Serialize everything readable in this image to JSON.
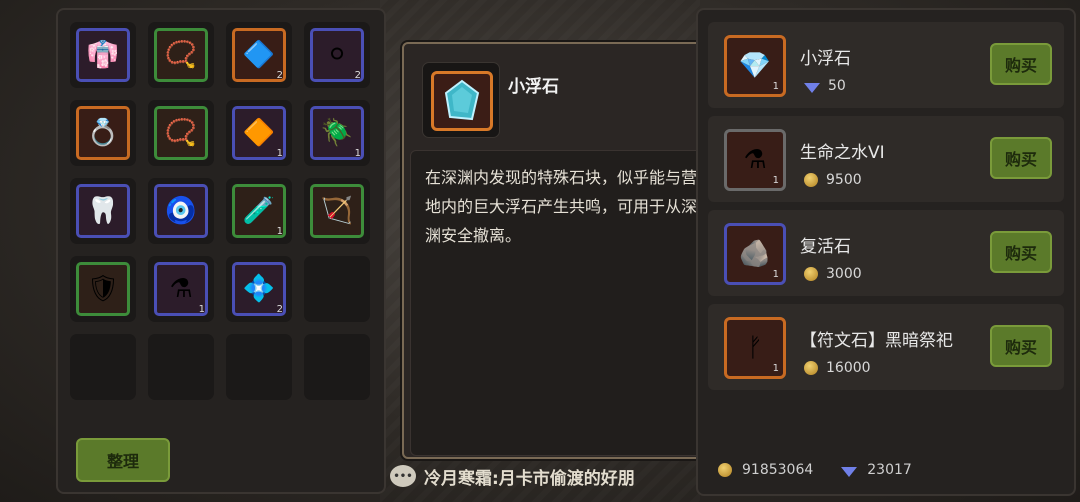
{
  "inventory": {
    "sort_label": "整理",
    "slots": [
      {
        "icon": "armor-icon",
        "glyph": "👘",
        "rarity": "blue",
        "count": ""
      },
      {
        "icon": "necklace-icon",
        "glyph": "📿",
        "rarity": "green",
        "count": ""
      },
      {
        "icon": "crystal-icon",
        "glyph": "🔷",
        "rarity": "orange",
        "count": "2"
      },
      {
        "icon": "orb-icon",
        "glyph": "⚪",
        "rarity": "blue",
        "count": "2"
      },
      {
        "icon": "ring-icon",
        "glyph": "💍",
        "rarity": "orange",
        "count": ""
      },
      {
        "icon": "necklace-icon",
        "glyph": "📿",
        "rarity": "green",
        "count": ""
      },
      {
        "icon": "amber-gem-icon",
        "glyph": "🔶",
        "rarity": "blue",
        "count": "1"
      },
      {
        "icon": "scarab-icon",
        "glyph": "🪲",
        "rarity": "blue",
        "count": "1"
      },
      {
        "icon": "fang-necklace-icon",
        "glyph": "🦷",
        "rarity": "blue",
        "count": ""
      },
      {
        "icon": "amulet-icon",
        "glyph": "🧿",
        "rarity": "blue",
        "count": ""
      },
      {
        "icon": "potion-vial-icon",
        "glyph": "🧪",
        "rarity": "green",
        "count": "1"
      },
      {
        "icon": "bow-icon",
        "glyph": "🏹",
        "rarity": "green",
        "count": ""
      },
      {
        "icon": "chest-armor-icon",
        "glyph": "🛡",
        "rarity": "green",
        "count": ""
      },
      {
        "icon": "red-potion-icon",
        "glyph": "⚗",
        "rarity": "blue",
        "count": "1"
      },
      {
        "icon": "blue-stone-icon",
        "glyph": "💠",
        "rarity": "blue",
        "count": "2"
      },
      {
        "icon": "",
        "glyph": "",
        "rarity": "empty",
        "count": ""
      },
      {
        "icon": "",
        "glyph": "",
        "rarity": "empty",
        "count": ""
      },
      {
        "icon": "",
        "glyph": "",
        "rarity": "empty",
        "count": ""
      },
      {
        "icon": "",
        "glyph": "",
        "rarity": "empty",
        "count": ""
      },
      {
        "icon": "",
        "glyph": "",
        "rarity": "empty",
        "count": ""
      }
    ]
  },
  "tooltip": {
    "name": "小浮石",
    "icon": "floating-stone-icon",
    "description": "在深渊内发现的特殊石块，似乎能与营地内的巨大浮石产生共鸣，可用于从深渊安全撤离。"
  },
  "shop": {
    "buy_label": "购买",
    "items": [
      {
        "name": "小浮石",
        "price": "50",
        "currency": "gem",
        "count": "1",
        "icon": "floating-stone-icon",
        "glyph": "💎",
        "rarity": "orange"
      },
      {
        "name": "生命之水VI",
        "price": "9500",
        "currency": "gold",
        "count": "1",
        "icon": "red-potion-icon",
        "glyph": "⚗",
        "rarity": "grey"
      },
      {
        "name": "复活石",
        "price": "3000",
        "currency": "gold",
        "count": "1",
        "icon": "revive-stone-icon",
        "glyph": "🪨",
        "rarity": "blue"
      },
      {
        "name": "【符文石】黑暗祭祀",
        "price": "16000",
        "currency": "gold",
        "count": "1",
        "icon": "rune-stone-icon",
        "glyph": "ᚠ",
        "rarity": "orange"
      }
    ],
    "gold_total": "91853064",
    "gem_total": "23017"
  },
  "chat": {
    "message": "冷月寒霜:月卡市偷渡的好朋"
  },
  "colors": {
    "buy_button": "#5b7a2a",
    "rarity_blue": "#4a4fb5",
    "rarity_green": "#3d8c3a",
    "rarity_orange": "#c86a22"
  }
}
